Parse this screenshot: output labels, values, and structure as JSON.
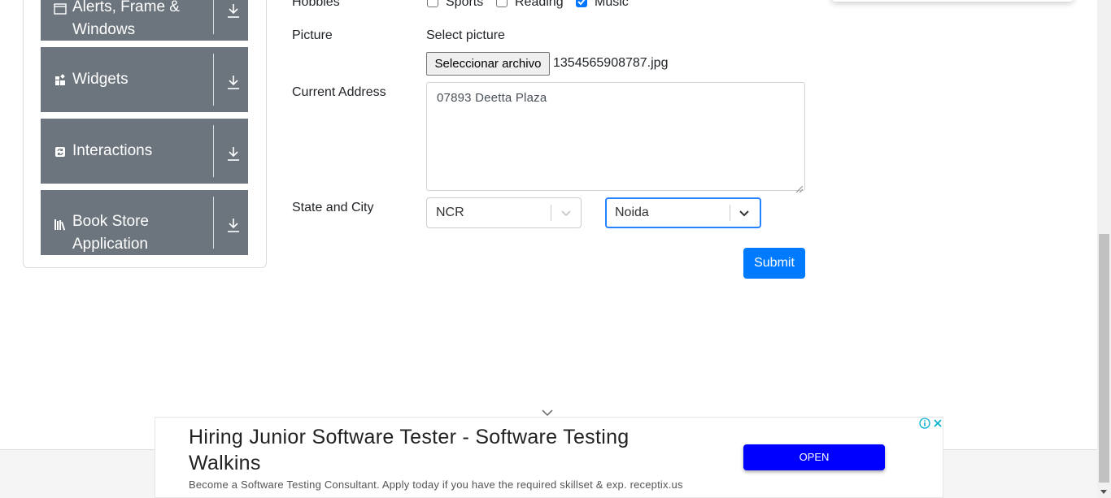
{
  "sidebar": {
    "items": [
      {
        "label": "Alerts, Frame & Windows",
        "icon": "window-icon"
      },
      {
        "label": "Widgets",
        "icon": "widgets-icon"
      },
      {
        "label": "Interactions",
        "icon": "interactions-icon"
      },
      {
        "label": "Book Store Application",
        "icon": "books-icon"
      }
    ]
  },
  "form": {
    "hobbies": {
      "label": "Hobbies",
      "options": [
        {
          "label": "Sports",
          "checked": false
        },
        {
          "label": "Reading",
          "checked": false
        },
        {
          "label": "Music",
          "checked": true
        }
      ]
    },
    "picture": {
      "label": "Picture",
      "prompt": "Select picture",
      "button_label": "Seleccionar archivo",
      "file_name": "1354565908787.jpg"
    },
    "address": {
      "label": "Current Address",
      "value": "07893 Deetta Plaza"
    },
    "state_city": {
      "label": "State and City",
      "state_value": "NCR",
      "city_value": "Noida"
    },
    "submit_label": "Submit"
  },
  "ad": {
    "title": "Hiring Junior Software Tester - Software Testing Walkins",
    "description": "Become a Software Testing Consultant. Apply today if you have the required skillset & exp. receptix.us",
    "cta_label": "OPEN"
  },
  "colors": {
    "sidebar_bg": "#6c757d",
    "primary": "#007bff",
    "ad_button": "#0000ff",
    "checkbox_checked": "#0075ff",
    "focus_border": "#2684ff"
  }
}
